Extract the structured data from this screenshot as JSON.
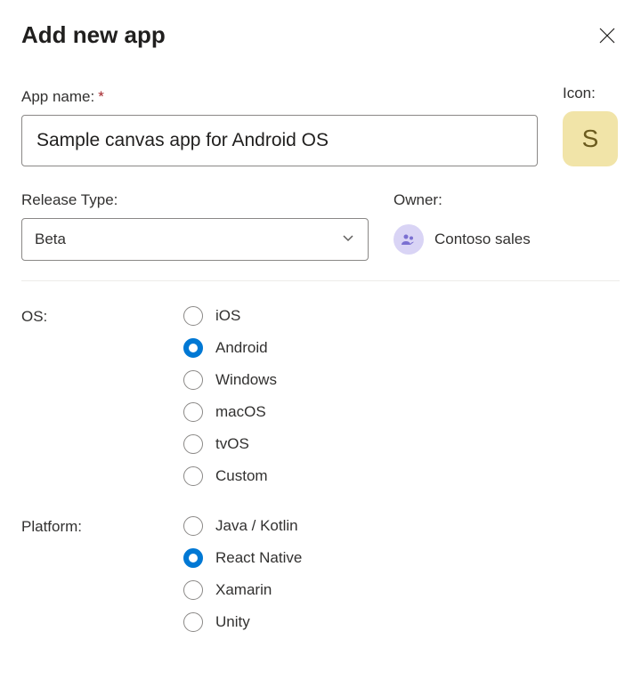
{
  "header": {
    "title": "Add new app"
  },
  "appName": {
    "label": "App name:",
    "required": "*",
    "value": "Sample canvas app for Android OS"
  },
  "icon": {
    "label": "Icon:",
    "letter": "S"
  },
  "releaseType": {
    "label": "Release Type:",
    "value": "Beta"
  },
  "owner": {
    "label": "Owner:",
    "value": "Contoso sales"
  },
  "os": {
    "label": "OS:",
    "options": [
      {
        "label": "iOS",
        "selected": false
      },
      {
        "label": "Android",
        "selected": true
      },
      {
        "label": "Windows",
        "selected": false
      },
      {
        "label": "macOS",
        "selected": false
      },
      {
        "label": "tvOS",
        "selected": false
      },
      {
        "label": "Custom",
        "selected": false
      }
    ]
  },
  "platform": {
    "label": "Platform:",
    "options": [
      {
        "label": "Java / Kotlin",
        "selected": false
      },
      {
        "label": "React Native",
        "selected": true
      },
      {
        "label": "Xamarin",
        "selected": false
      },
      {
        "label": "Unity",
        "selected": false
      }
    ]
  }
}
